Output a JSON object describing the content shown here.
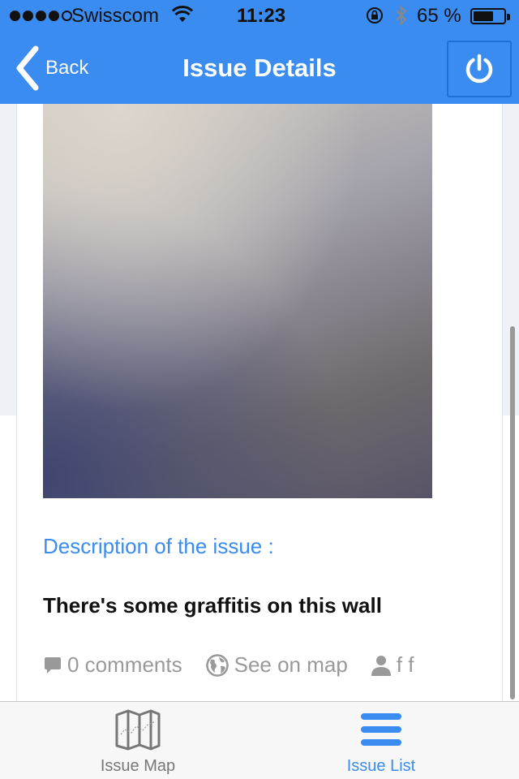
{
  "status_bar": {
    "carrier": "Swisscom",
    "time": "11:23",
    "battery_percent": "65 %",
    "battery_level": 0.65,
    "signal_bars": 4
  },
  "navbar": {
    "back_label": "Back",
    "title": "Issue Details"
  },
  "issue": {
    "description_label": "Description of the issue :",
    "description": "There's some graffitis on this wall",
    "comments": "0 comments",
    "map_link": "See on map",
    "author": "f f"
  },
  "tabbar": {
    "tabs": [
      {
        "label": "Issue Map",
        "icon": "map-icon",
        "active": false
      },
      {
        "label": "Issue List",
        "icon": "list-icon",
        "active": true
      }
    ]
  },
  "colors": {
    "accent": "#3a8cf0",
    "muted_text": "#999999"
  }
}
